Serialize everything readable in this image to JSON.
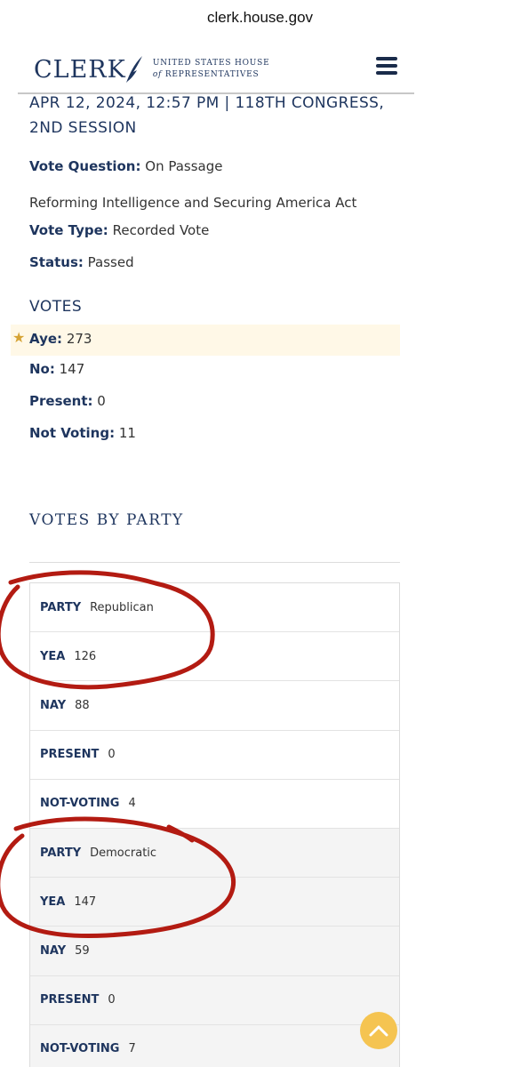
{
  "browser": {
    "url": "clerk.house.gov"
  },
  "header": {
    "logo_word": "CLERK",
    "logo_line1": "UNITED STATES HOUSE",
    "logo_of": "of",
    "logo_line2": "REPRESENTATIVES",
    "menu_icon": "hamburger-icon"
  },
  "vote": {
    "date_session": "APR 12, 2024, 12:57 PM | 118TH CONGRESS, 2ND SESSION",
    "question_label": "Vote Question:",
    "question_value": "On Passage",
    "bill_title": "Reforming Intelligence and Securing America Act",
    "type_label": "Vote Type:",
    "type_value": "Recorded Vote",
    "status_label": "Status:",
    "status_value": "Passed"
  },
  "votes": {
    "heading": "VOTES",
    "aye_label": "Aye:",
    "aye_value": "273",
    "no_label": "No:",
    "no_value": "147",
    "present_label": "Present:",
    "present_value": "0",
    "notvoting_label": "Not Voting:",
    "notvoting_value": "11"
  },
  "by_party": {
    "heading": "VOTES BY PARTY",
    "parties": [
      {
        "party_label": "PARTY",
        "party": "Republican",
        "yea_label": "YEA",
        "yea": "126",
        "nay_label": "NAY",
        "nay": "88",
        "present_label": "PRESENT",
        "present": "0",
        "nv_label": "NOT-VOTING",
        "nv": "4"
      },
      {
        "party_label": "PARTY",
        "party": "Democratic",
        "yea_label": "YEA",
        "yea": "147",
        "nay_label": "NAY",
        "nay": "59",
        "present_label": "PRESENT",
        "present": "0",
        "nv_label": "NOT-VOTING",
        "nv": "7"
      }
    ]
  },
  "colors": {
    "navy": "#1e355e",
    "highlight": "#fff8e7",
    "star": "#d6a334",
    "annotation": "#b31b12",
    "scroll_button": "#f5c451"
  },
  "icons": {
    "star": "star-icon",
    "scroll": "chevron-up-icon"
  }
}
